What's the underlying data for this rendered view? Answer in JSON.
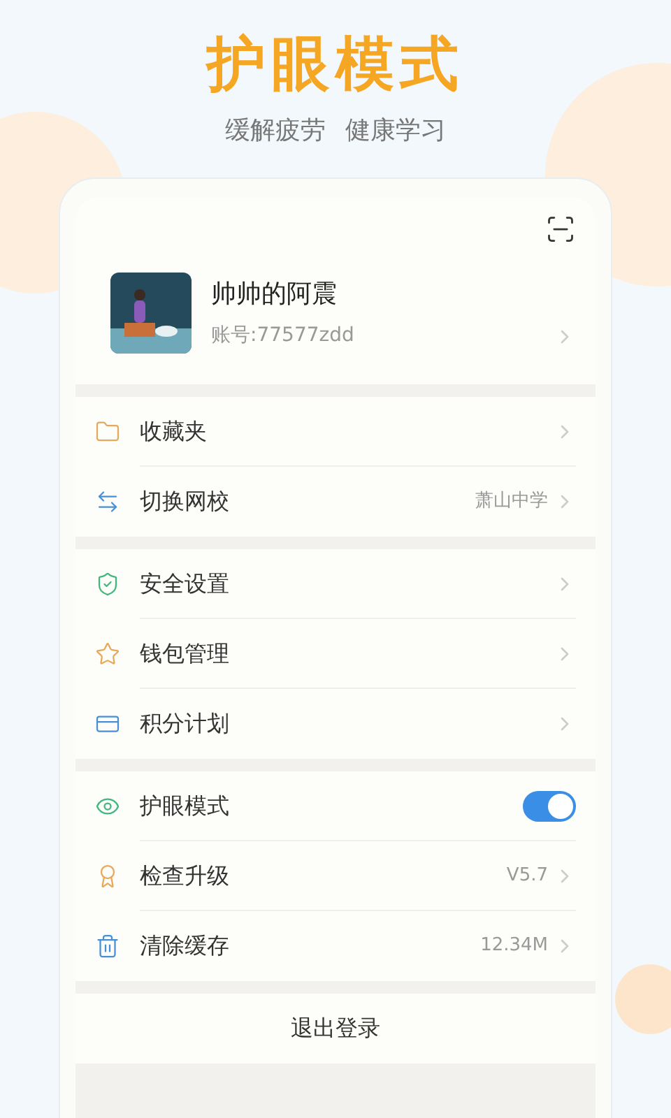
{
  "header": {
    "title": "护眼模式",
    "subtitle": [
      "缓解疲劳",
      "健康学习"
    ]
  },
  "profile": {
    "name": "帅帅的阿震",
    "account": "账号:77577zdd"
  },
  "groups": [
    {
      "items": [
        {
          "kind": "link",
          "label": "收藏夹"
        },
        {
          "kind": "link",
          "label": "切换网校",
          "value": "萧山中学"
        }
      ]
    },
    {
      "items": [
        {
          "kind": "link",
          "label": "安全设置"
        },
        {
          "kind": "link",
          "label": "钱包管理"
        },
        {
          "kind": "link",
          "label": "积分计划"
        }
      ]
    },
    {
      "items": [
        {
          "kind": "toggle",
          "label": "护眼模式",
          "on": true
        },
        {
          "kind": "link",
          "label": "检查升级",
          "value": "V5.7"
        },
        {
          "kind": "link",
          "label": "清除缓存",
          "value": "12.34M"
        }
      ]
    }
  ],
  "logout": "退出登录"
}
